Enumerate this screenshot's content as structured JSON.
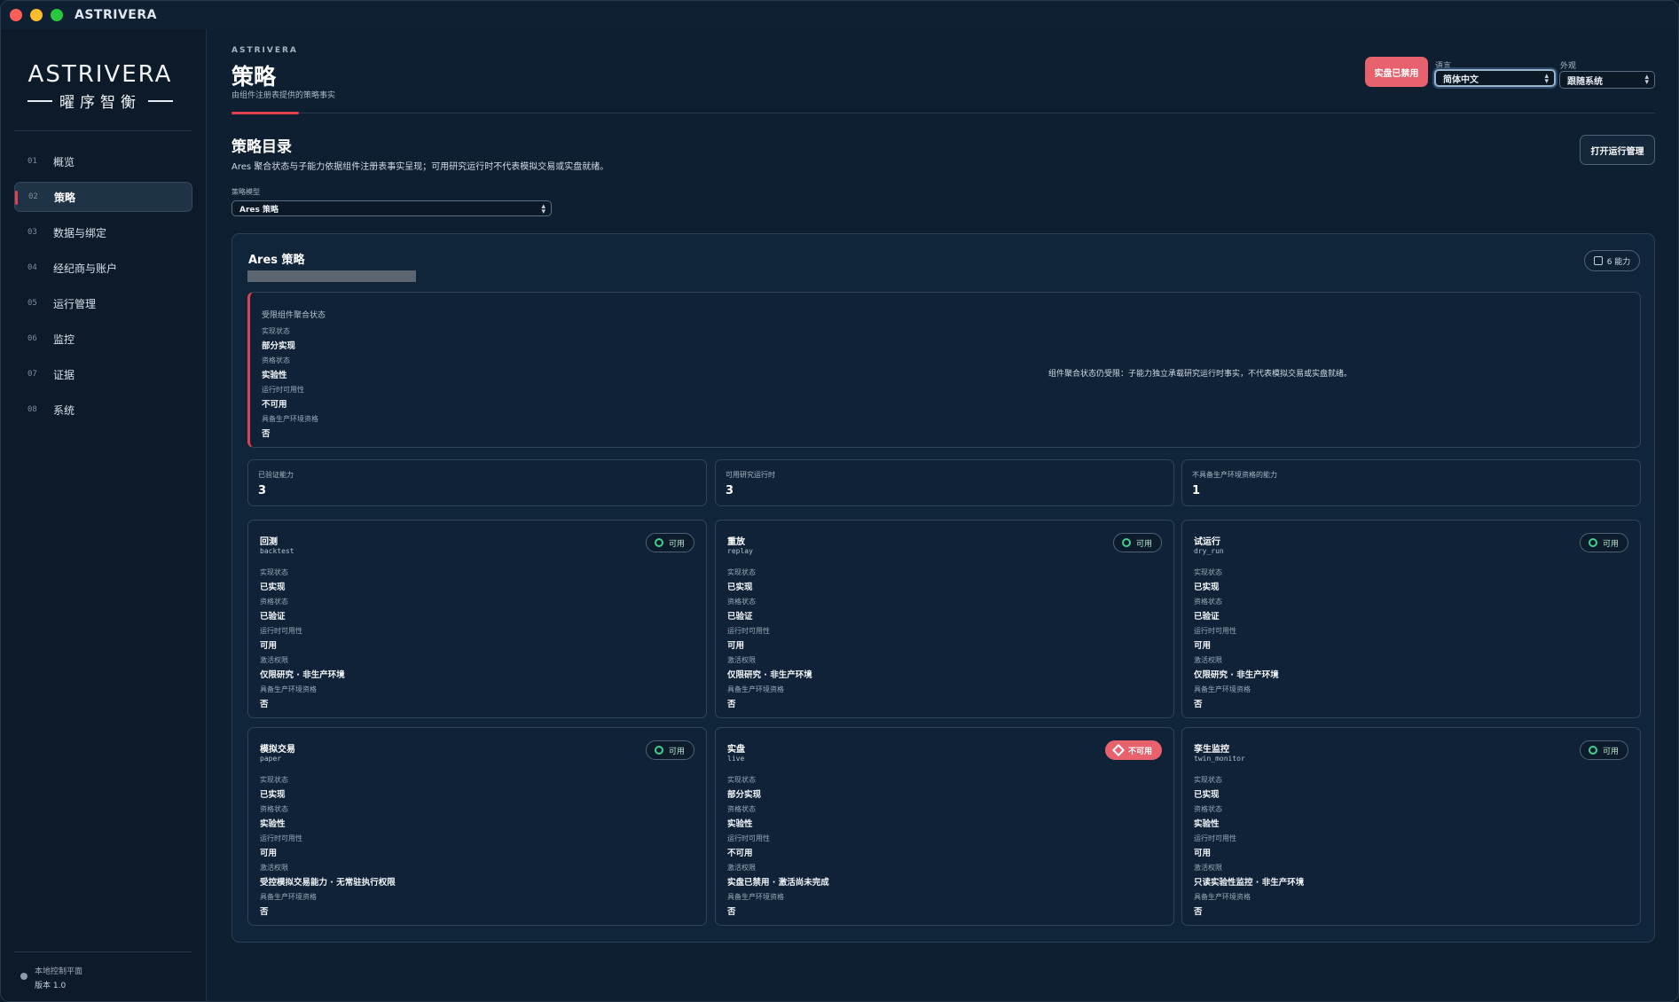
{
  "app_title": "ASTRIVERA",
  "logo": {
    "main": "ASTRIVERA",
    "sub": "曜序智衡"
  },
  "sidebar": {
    "items": [
      {
        "num": "01",
        "label": "概览"
      },
      {
        "num": "02",
        "label": "策略"
      },
      {
        "num": "03",
        "label": "数据与绑定"
      },
      {
        "num": "04",
        "label": "经纪商与账户"
      },
      {
        "num": "05",
        "label": "运行管理"
      },
      {
        "num": "06",
        "label": "监控"
      },
      {
        "num": "07",
        "label": "证据"
      },
      {
        "num": "08",
        "label": "系统"
      }
    ],
    "active_index": 1,
    "status_line1": "本地控制平面",
    "status_line2": "版本 1.0"
  },
  "header": {
    "kicker": "ASTRIVERA",
    "title": "策略",
    "subtitle": "由组件注册表提供的策略事实",
    "live_badge": "实盘已禁用",
    "language_label": "语言",
    "language_value": "简体中文",
    "appearance_label": "外观",
    "appearance_value": "跟随系统"
  },
  "catalog": {
    "title": "策略目录",
    "description": "Ares 聚合状态与子能力依据组件注册表事实呈现；可用研究运行时不代表模拟交易或实盘就绪。",
    "open_button": "打开运行管理",
    "model_label": "策略模型",
    "model_value": "Ares 策略"
  },
  "panel": {
    "title": "Ares 策略",
    "capability_chip": "6 能力",
    "aggregate": {
      "title": "受限组件聚合状态",
      "fields": [
        {
          "k": "实现状态",
          "v": "部分实现"
        },
        {
          "k": "资格状态",
          "v": "实验性"
        },
        {
          "k": "运行时可用性",
          "v": "不可用"
        },
        {
          "k": "具备生产环境资格",
          "v": "否"
        }
      ],
      "note": "组件聚合状态仍受限：子能力独立承载研究运行时事实，不代表模拟交易或实盘就绪。"
    },
    "stats": [
      {
        "k": "已验证能力",
        "v": "3"
      },
      {
        "k": "可用研究运行时",
        "v": "3"
      },
      {
        "k": "不具备生产环境资格的能力",
        "v": "1"
      }
    ],
    "cards": [
      {
        "title": "回测",
        "code": "backtest",
        "badge": "可用",
        "ok": true,
        "fields": [
          {
            "k": "实现状态",
            "v": "已实现"
          },
          {
            "k": "资格状态",
            "v": "已验证"
          },
          {
            "k": "运行时可用性",
            "v": "可用"
          },
          {
            "k": "激活权限",
            "v": "仅限研究 · 非生产环境"
          },
          {
            "k": "具备生产环境资格",
            "v": "否"
          }
        ]
      },
      {
        "title": "重放",
        "code": "replay",
        "badge": "可用",
        "ok": true,
        "fields": [
          {
            "k": "实现状态",
            "v": "已实现"
          },
          {
            "k": "资格状态",
            "v": "已验证"
          },
          {
            "k": "运行时可用性",
            "v": "可用"
          },
          {
            "k": "激活权限",
            "v": "仅限研究 · 非生产环境"
          },
          {
            "k": "具备生产环境资格",
            "v": "否"
          }
        ]
      },
      {
        "title": "试运行",
        "code": "dry_run",
        "badge": "可用",
        "ok": true,
        "fields": [
          {
            "k": "实现状态",
            "v": "已实现"
          },
          {
            "k": "资格状态",
            "v": "已验证"
          },
          {
            "k": "运行时可用性",
            "v": "可用"
          },
          {
            "k": "激活权限",
            "v": "仅限研究 · 非生产环境"
          },
          {
            "k": "具备生产环境资格",
            "v": "否"
          }
        ]
      },
      {
        "title": "模拟交易",
        "code": "paper",
        "badge": "可用",
        "ok": true,
        "fields": [
          {
            "k": "实现状态",
            "v": "已实现"
          },
          {
            "k": "资格状态",
            "v": "实验性"
          },
          {
            "k": "运行时可用性",
            "v": "可用"
          },
          {
            "k": "激活权限",
            "v": "受控模拟交易能力 · 无常驻执行权限"
          },
          {
            "k": "具备生产环境资格",
            "v": "否"
          }
        ]
      },
      {
        "title": "实盘",
        "code": "live",
        "badge": "不可用",
        "ok": false,
        "fields": [
          {
            "k": "实现状态",
            "v": "部分实现"
          },
          {
            "k": "资格状态",
            "v": "实验性"
          },
          {
            "k": "运行时可用性",
            "v": "不可用"
          },
          {
            "k": "激活权限",
            "v": "实盘已禁用 · 激活尚未完成"
          },
          {
            "k": "具备生产环境资格",
            "v": "否"
          }
        ]
      },
      {
        "title": "孪生监控",
        "code": "twin_monitor",
        "badge": "可用",
        "ok": true,
        "fields": [
          {
            "k": "实现状态",
            "v": "已实现"
          },
          {
            "k": "资格状态",
            "v": "实验性"
          },
          {
            "k": "运行时可用性",
            "v": "可用"
          },
          {
            "k": "激活权限",
            "v": "只读实验性监控 · 非生产环境"
          },
          {
            "k": "具备生产环境资格",
            "v": "否"
          }
        ]
      }
    ]
  },
  "colors": {
    "accent_red": "#e0424f",
    "badge_red": "#e8626e",
    "ok_green": "#3fd08a",
    "background": "#0e1f31"
  }
}
